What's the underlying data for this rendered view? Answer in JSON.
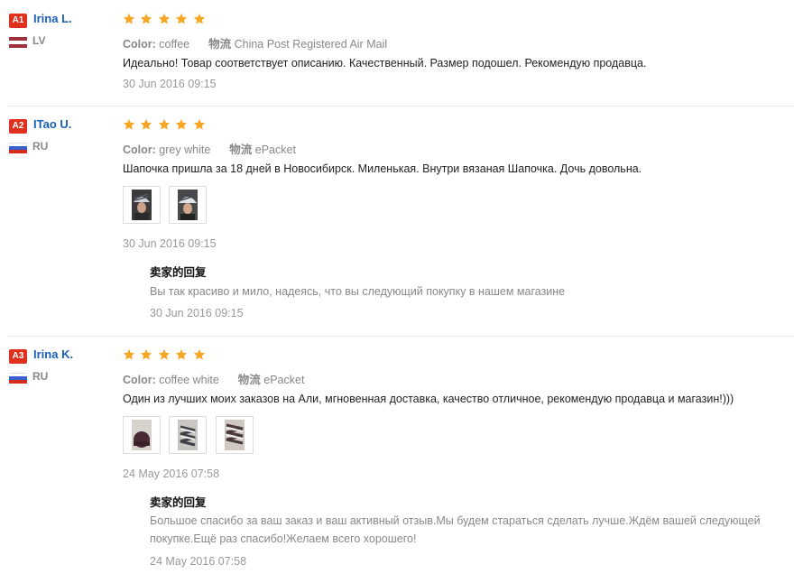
{
  "reviews": [
    {
      "badge": "A1",
      "name": "Irina L.",
      "country": "LV",
      "rating": 5,
      "color_label": "Color:",
      "color_value": "coffee",
      "shipping_label": "物流",
      "shipping_value": "China Post Registered Air Mail",
      "text": "Идеально! Товар соответствует описанию. Качественный. Размер подошел. Рекомендую продавца.",
      "date": "30 Jun 2016 09:15"
    },
    {
      "badge": "A2",
      "name": "ITao U.",
      "country": "RU",
      "rating": 5,
      "color_label": "Color:",
      "color_value": "grey white",
      "shipping_label": "物流",
      "shipping_value": "ePacket",
      "text": "Шапочка пришла за 18 дней в Новосибирск. Миленькая. Внутри вязаная Шапочка. Дочь довольна.",
      "photos": [
        "photo-1",
        "photo-2"
      ],
      "date": "30 Jun 2016 09:15",
      "reply": {
        "title": "卖家的回复",
        "lines": [
          "Вы так красиво и мило, надеясь, что вы следующий покупку в нашем магазине"
        ],
        "date": "30 Jun 2016 09:15"
      }
    },
    {
      "badge": "A3",
      "name": "Irina K.",
      "country": "RU",
      "rating": 5,
      "color_label": "Color:",
      "color_value": "coffee white",
      "shipping_label": "物流",
      "shipping_value": "ePacket",
      "text": "Один из лучших моих заказов на Али, мгновенная доставка, качество отличное, рекомендую продавца и магазин!)))",
      "photos": [
        "photo-1",
        "photo-2",
        "photo-3"
      ],
      "date": "24 May 2016 07:58",
      "reply": {
        "title": "卖家的回复",
        "lines": [
          "Большое спасибо за ваш заказ и ваш активный отзыв.Мы будем стараться сделать лучше.Ждём вашей следующей",
          "покупке.Ещё раз спасибо!Желаем всего хорошего!"
        ],
        "date": "24 May 2016 07:58"
      }
    }
  ],
  "colors": {
    "badge": "#e0301e",
    "name": "#1a5fb4",
    "star": "#f5a623",
    "muted": "#888888",
    "flag_lv": "#9e3039",
    "flag_ru_white": "#ffffff",
    "flag_ru_blue": "#3a5fcd",
    "flag_ru_red": "#d52b1e"
  },
  "icons": {
    "star": "star-icon",
    "flag": "country-flag-icon"
  }
}
